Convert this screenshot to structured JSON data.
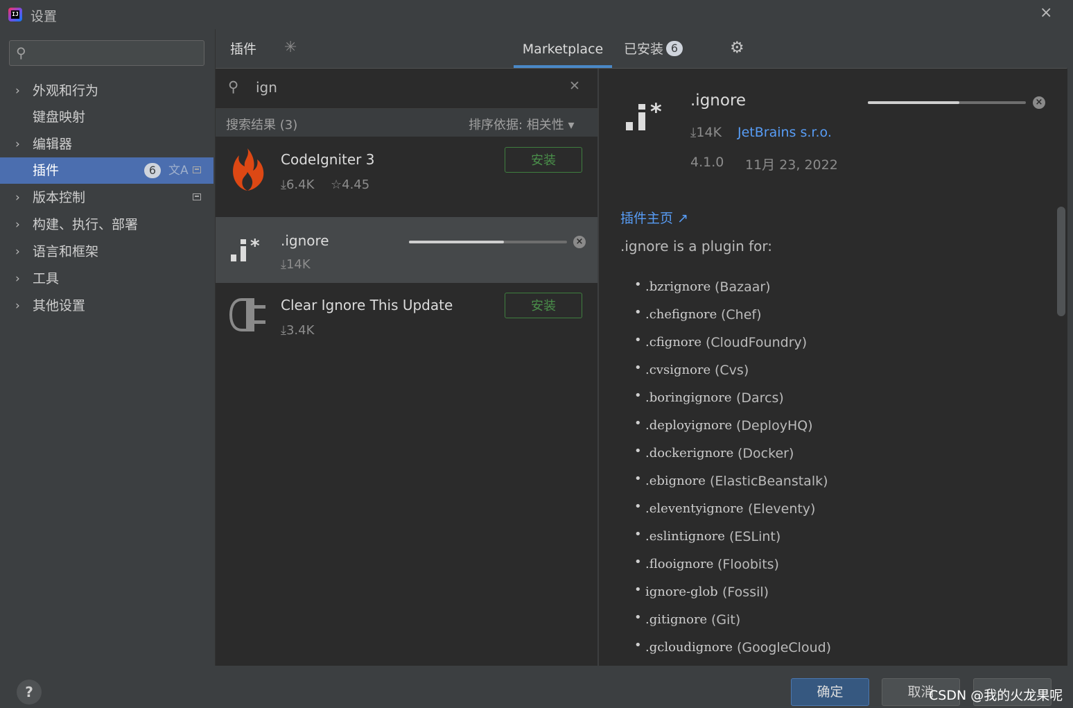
{
  "window": {
    "title": "设置",
    "close": "×"
  },
  "sidebar": {
    "items": [
      {
        "label": "外观和行为",
        "expandable": true
      },
      {
        "label": "键盘映射",
        "expandable": false
      },
      {
        "label": "编辑器",
        "expandable": true
      },
      {
        "label": "插件",
        "expandable": false,
        "selected": true,
        "badge": "6"
      },
      {
        "label": "版本控制",
        "expandable": true
      },
      {
        "label": "构建、执行、部署",
        "expandable": true
      },
      {
        "label": "语言和框架",
        "expandable": true
      },
      {
        "label": "工具",
        "expandable": true
      },
      {
        "label": "其他设置",
        "expandable": true
      }
    ]
  },
  "header": {
    "title": "插件",
    "tabs": [
      {
        "label": "Marketplace",
        "active": true
      },
      {
        "label": "已安装",
        "count": "6"
      }
    ]
  },
  "search": {
    "value": "ign",
    "results": "搜索结果 (3)",
    "sort": "排序依据: 相关性 ▾"
  },
  "plugins": [
    {
      "name": "CodeIgniter 3",
      "downloads": "⤓6.4K",
      "rating": "☆4.45",
      "action": "安装",
      "progress": null
    },
    {
      "name": ".ignore",
      "downloads": "⤓14K",
      "rating": "",
      "action": "",
      "progress": 0.6
    },
    {
      "name": "Clear Ignore This Update",
      "downloads": "⤓3.4K",
      "rating": "",
      "action": "安装",
      "progress": null
    }
  ],
  "detail": {
    "name": ".ignore",
    "downloads": "⤓14K",
    "vendor": "JetBrains s.r.o.",
    "version": "4.1.0",
    "date": "11月 23, 2022",
    "homepage": "插件主页 ↗",
    "description": ".ignore is a plugin for:",
    "progress": 0.58,
    "list": [
      {
        "code": ".bzrignore",
        "name": "(Bazaar)"
      },
      {
        "code": ".chefignore",
        "name": "(Chef)"
      },
      {
        "code": ".cfignore",
        "name": "(CloudFoundry)"
      },
      {
        "code": ".cvsignore",
        "name": "(Cvs)"
      },
      {
        "code": ".boringignore",
        "name": "(Darcs)"
      },
      {
        "code": ".deployignore",
        "name": "(DeployHQ)"
      },
      {
        "code": ".dockerignore",
        "name": "(Docker)"
      },
      {
        "code": ".ebignore",
        "name": "(ElasticBeanstalk)"
      },
      {
        "code": ".eleventyignore",
        "name": "(Eleventy)"
      },
      {
        "code": ".eslintignore",
        "name": "(ESLint)"
      },
      {
        "code": ".flooignore",
        "name": "(Floobits)"
      },
      {
        "code": "ignore-glob",
        "name": "(Fossil)"
      },
      {
        "code": ".gitignore",
        "name": "(Git)"
      },
      {
        "code": ".gcloudignore",
        "name": "(GoogleCloud)"
      }
    ]
  },
  "footer": {
    "ok": "确定",
    "cancel": "取消",
    "watermark": "CSDN @我的火龙果呢"
  },
  "colors": {
    "accent": "#4b6eaf",
    "link": "#589df6",
    "install": "#4a8f4a",
    "flame": "#dd4814"
  }
}
